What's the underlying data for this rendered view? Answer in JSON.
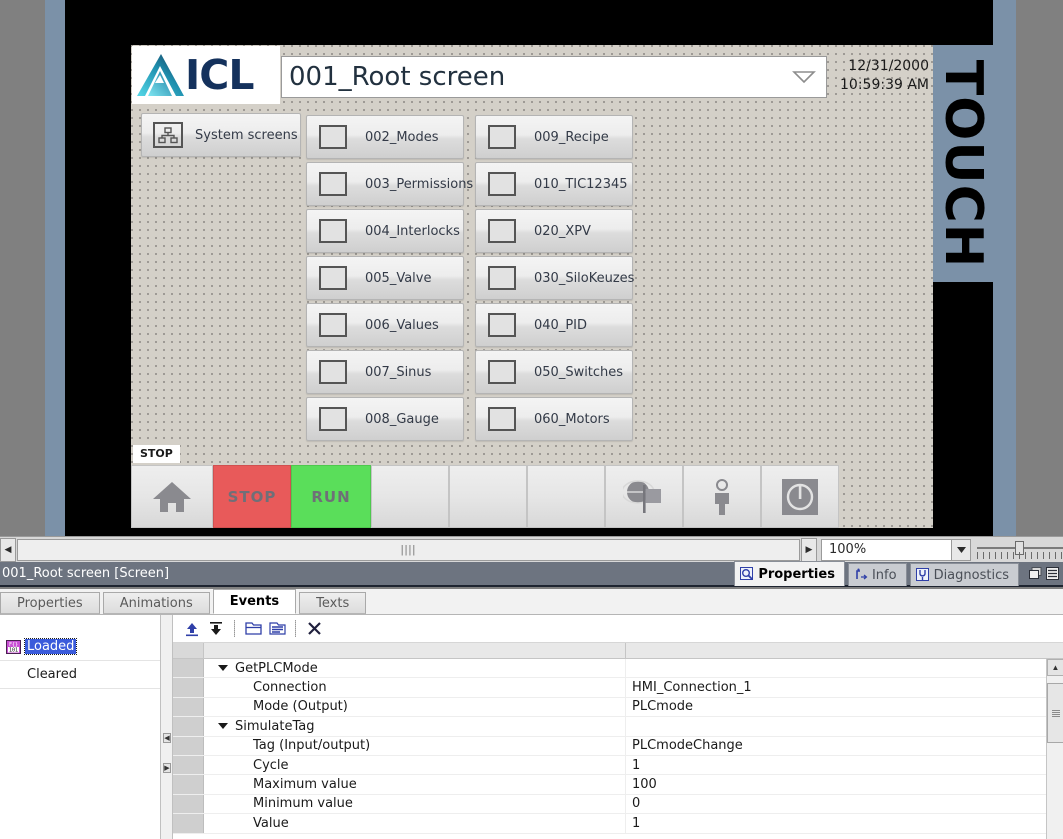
{
  "hmi": {
    "logo_text": "ICL",
    "title": "001_Root screen",
    "date": "12/31/2000",
    "time": "10:59:39 AM",
    "side_panel_text": "TOUCH",
    "system_button": {
      "label": "System screens",
      "icon": "hierarchy-icon"
    },
    "nav_buttons_left": [
      {
        "label": "002_Modes"
      },
      {
        "label": "003_Permissions"
      },
      {
        "label": "004_Interlocks"
      },
      {
        "label": "005_Valve"
      },
      {
        "label": "006_Values"
      },
      {
        "label": "007_Sinus"
      },
      {
        "label": "008_Gauge"
      }
    ],
    "nav_buttons_right": [
      {
        "label": "009_Recipe"
      },
      {
        "label": "010_TIC12345"
      },
      {
        "label": "020_XPV"
      },
      {
        "label": "030_SiloKeuzes"
      },
      {
        "label": "040_PID"
      },
      {
        "label": "050_Switches"
      },
      {
        "label": "060_Motors"
      }
    ],
    "tooltip": "STOP",
    "bottom_bar": [
      {
        "kind": "icon",
        "icon": "home-icon",
        "label": ""
      },
      {
        "kind": "text",
        "label": "STOP",
        "color": "#e85a5a"
      },
      {
        "kind": "text",
        "label": "RUN",
        "color": "#5ade5a"
      },
      {
        "kind": "empty",
        "label": ""
      },
      {
        "kind": "empty",
        "label": ""
      },
      {
        "kind": "empty",
        "label": ""
      },
      {
        "kind": "icon",
        "icon": "globe-flag-icon",
        "label": ""
      },
      {
        "kind": "icon",
        "icon": "person-icon",
        "label": ""
      },
      {
        "kind": "icon",
        "icon": "power-icon",
        "label": ""
      }
    ]
  },
  "scrollstrip": {
    "left_arrow": "◀",
    "right_arrow": "▶",
    "grip": "||||",
    "zoom_value": "100%"
  },
  "statusbar": {
    "title": "001_Root screen [Screen]",
    "tabs": [
      {
        "label": "Properties",
        "icon": "properties-icon",
        "active": true
      },
      {
        "label": "Info",
        "icon": "info-icon",
        "active": false
      },
      {
        "label": "Diagnostics",
        "icon": "diagnostics-icon",
        "active": false
      }
    ]
  },
  "property_tabs": [
    {
      "label": "Properties",
      "active": false
    },
    {
      "label": "Animations",
      "active": false
    },
    {
      "label": "Events",
      "active": true
    },
    {
      "label": "Texts",
      "active": false
    }
  ],
  "events": {
    "list": [
      {
        "label": "Loaded",
        "selected": true,
        "icon": "function-icon"
      },
      {
        "label": "Cleared",
        "selected": false,
        "icon": ""
      }
    ],
    "toolbar": [
      {
        "icon": "move-up-icon"
      },
      {
        "icon": "move-down-icon"
      },
      {
        "icon": "open-folder-icon"
      },
      {
        "icon": "list-icon"
      },
      {
        "icon": "delete-icon"
      }
    ],
    "rows": [
      {
        "type": "group",
        "name": "GetPLCMode",
        "value": ""
      },
      {
        "type": "child",
        "name": "Connection",
        "value": "HMI_Connection_1"
      },
      {
        "type": "child",
        "name": "Mode (Output)",
        "value": "PLCmode"
      },
      {
        "type": "group",
        "name": "SimulateTag",
        "value": ""
      },
      {
        "type": "child",
        "name": "Tag (Input/output)",
        "value": "PLCmodeChange"
      },
      {
        "type": "child",
        "name": "Cycle",
        "value": "1"
      },
      {
        "type": "child",
        "name": "Maximum value",
        "value": "100"
      },
      {
        "type": "child",
        "name": "Minimum value",
        "value": "0"
      },
      {
        "type": "child",
        "name": "Value",
        "value": "1"
      }
    ]
  },
  "colors": {
    "hmi_background": "#d4d0c8",
    "touch_panel": "#7b91a8",
    "stop_red": "#e85a5a",
    "run_green": "#5ade5a",
    "selection_blue": "#3b5bdb",
    "statusbar": "#6d7480"
  }
}
